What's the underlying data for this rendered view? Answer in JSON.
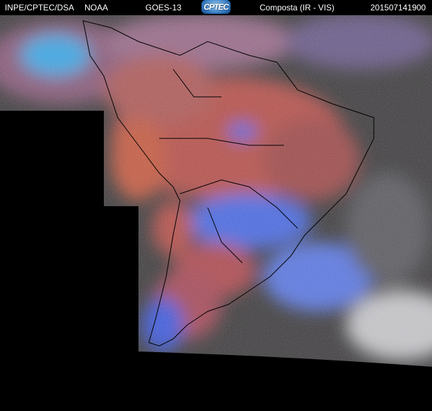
{
  "header": {
    "agency": "INPE/CPTEC/DSA",
    "partner": "NOAA",
    "satellite": "GOES-13",
    "logo_text": "CPTEC",
    "product": "Composta (IR - VIS)",
    "timestamp": "201507141900"
  },
  "colors": {
    "background": "#000000",
    "warm_surface": "#b8504a",
    "low_cloud": "#3c3c3c",
    "high_cloud": "#4a66e6",
    "thick_cloud": "#c8c8c8"
  }
}
